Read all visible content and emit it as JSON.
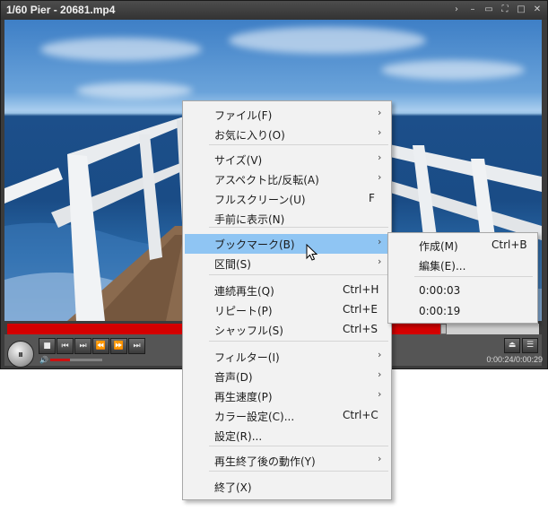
{
  "window": {
    "title": "1/60 Pier - 20681.mp4",
    "controls": [
      "›",
      "–",
      "▭",
      "⛶",
      "□",
      "✕"
    ]
  },
  "player": {
    "progress_fraction": 0.82,
    "volume_fraction": 0.38,
    "time_display": "0:00:24/0:00:29",
    "colors": {
      "seek_fill": "#d40000",
      "menu_highlight": "#8fc5f3"
    },
    "icons": {
      "play_pause": "⏸",
      "stop": "■",
      "prev": "⏮",
      "next": "⏭",
      "rewind": "⏪",
      "forward": "⏩",
      "step": "⏭",
      "eject": "⏏",
      "playlist": "☰",
      "volume": "🔊"
    }
  },
  "menu": {
    "items": [
      {
        "label": "ファイル(F)",
        "shortcut": "",
        "submenu": true
      },
      {
        "label": "お気に入り(O)",
        "shortcut": "",
        "submenu": true
      },
      {
        "label": "サイズ(V)",
        "shortcut": "",
        "submenu": true
      },
      {
        "label": "アスペクト比/反転(A)",
        "shortcut": "",
        "submenu": true
      },
      {
        "label": "フルスクリーン(U)",
        "shortcut": "F",
        "submenu": false
      },
      {
        "label": "手前に表示(N)",
        "shortcut": "",
        "submenu": false
      },
      {
        "label": "ブックマーク(B)",
        "shortcut": "",
        "submenu": true
      },
      {
        "label": "区間(S)",
        "shortcut": "",
        "submenu": true
      },
      {
        "label": "連続再生(Q)",
        "shortcut": "Ctrl+H",
        "submenu": false
      },
      {
        "label": "リピート(P)",
        "shortcut": "Ctrl+E",
        "submenu": false
      },
      {
        "label": "シャッフル(S)",
        "shortcut": "Ctrl+S",
        "submenu": false
      },
      {
        "label": "フィルター(I)",
        "shortcut": "",
        "submenu": true
      },
      {
        "label": "音声(D)",
        "shortcut": "",
        "submenu": true
      },
      {
        "label": "再生速度(P)",
        "shortcut": "",
        "submenu": true
      },
      {
        "label": "カラー設定(C)...",
        "shortcut": "Ctrl+C",
        "submenu": false
      },
      {
        "label": "設定(R)...",
        "shortcut": "",
        "submenu": false
      },
      {
        "label": "再生終了後の動作(Y)",
        "shortcut": "",
        "submenu": true
      },
      {
        "label": "終了(X)",
        "shortcut": "",
        "submenu": false
      }
    ],
    "arrow": "›"
  },
  "submenu": {
    "items": [
      {
        "label": "作成(M)",
        "shortcut": "Ctrl+B"
      },
      {
        "label": "編集(E)...",
        "shortcut": ""
      },
      {
        "label": "0:00:03",
        "shortcut": ""
      },
      {
        "label": "0:00:19",
        "shortcut": ""
      }
    ]
  }
}
